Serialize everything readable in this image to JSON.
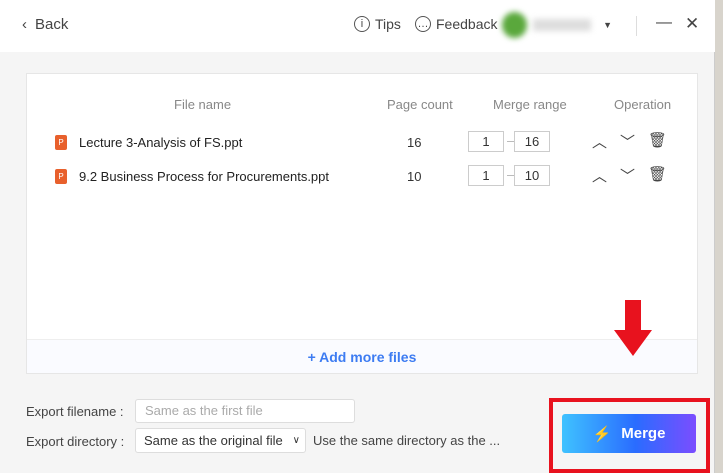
{
  "titlebar": {
    "back": "Back",
    "tips": "Tips",
    "feedback": "Feedback"
  },
  "table": {
    "headers": [
      "File name",
      "Page count",
      "Merge range",
      "Operation"
    ],
    "rows": [
      {
        "name": "Lecture 3-Analysis of FS.ppt",
        "pages": "16",
        "from": "1",
        "to": "16"
      },
      {
        "name": "9.2 Business Process for Procurements.ppt",
        "pages": "10",
        "from": "1",
        "to": "10"
      }
    ]
  },
  "add_files": "+ Add more files",
  "export": {
    "filename_label": "Export filename :",
    "filename_placeholder": "Same as the first file",
    "directory_label": "Export directory :",
    "directory_value": "Same as the original file",
    "directory_hint": "Use the same directory as the ..."
  },
  "merge_label": "Merge",
  "colors": {
    "accent": "#3d7cf2",
    "highlight": "#e8121e"
  }
}
